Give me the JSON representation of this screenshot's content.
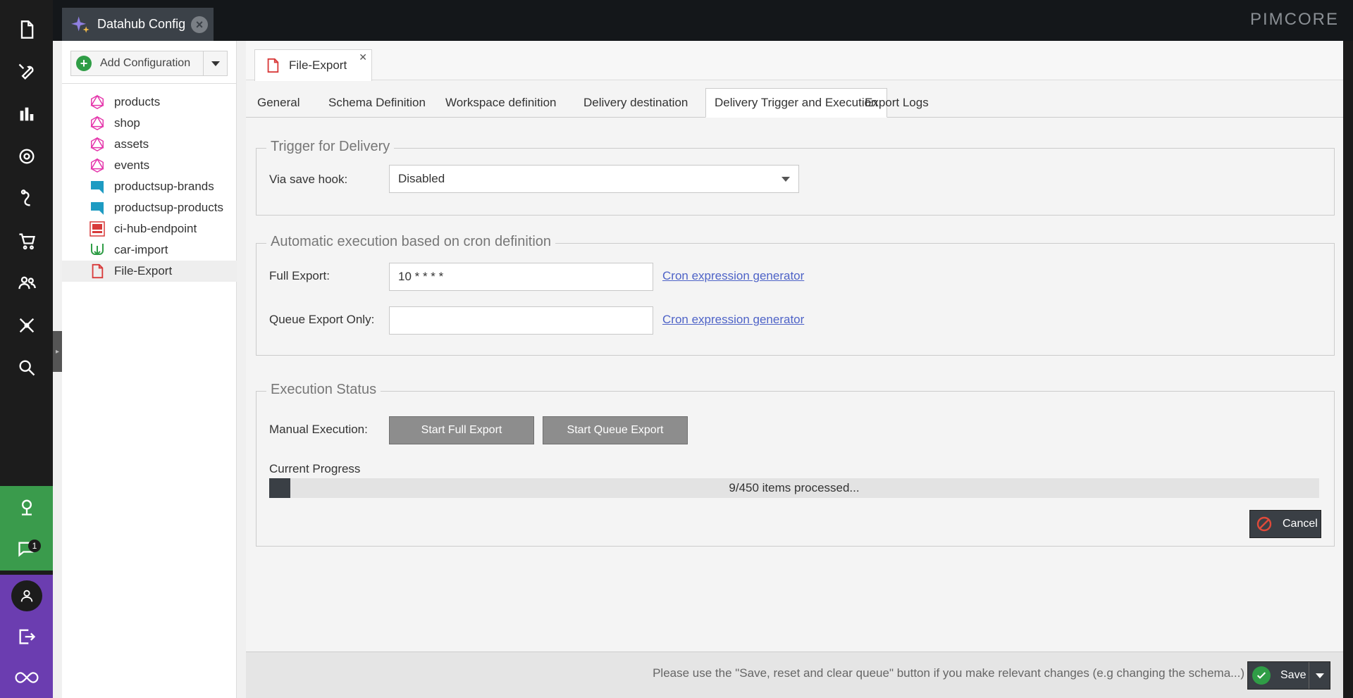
{
  "rail": {
    "icons": [
      "document-icon",
      "wrench-icon",
      "bar-chart-icon",
      "gear-icon",
      "marketing-icon",
      "cart-icon",
      "users-icon",
      "network-icon",
      "search-icon"
    ],
    "notifications_badge": "1"
  },
  "topbar": {
    "tab_label": "Datahub Config",
    "brand": "PIMCORE"
  },
  "tree": {
    "add_button_label": "Add Configuration",
    "items": [
      {
        "label": "products",
        "icon": "graphql-icon"
      },
      {
        "label": "shop",
        "icon": "graphql-icon"
      },
      {
        "label": "assets",
        "icon": "graphql-icon"
      },
      {
        "label": "events",
        "icon": "graphql-icon"
      },
      {
        "label": "productsup-brands",
        "icon": "productsup-icon"
      },
      {
        "label": "productsup-products",
        "icon": "productsup-icon"
      },
      {
        "label": "ci-hub-endpoint",
        "icon": "cihub-icon"
      },
      {
        "label": "car-import",
        "icon": "import-icon"
      },
      {
        "label": "File-Export",
        "icon": "file-icon"
      }
    ]
  },
  "doc": {
    "tab_label": "File-Export",
    "sub_tabs": [
      "General",
      "Schema Definition",
      "Workspace definition",
      "Delivery destination",
      "Delivery Trigger and Execution",
      "Export Logs"
    ]
  },
  "trigger": {
    "legend": "Trigger for Delivery",
    "save_hook_label": "Via save hook:",
    "save_hook_value": "Disabled"
  },
  "cron": {
    "legend": "Automatic execution based on cron definition",
    "full_label": "Full Export:",
    "full_value": "10 * * * *",
    "queue_label": "Queue Export Only:",
    "queue_value": "",
    "generator_link": "Cron expression generator"
  },
  "execution": {
    "legend": "Execution Status",
    "manual_label": "Manual Execution:",
    "start_full": "Start Full Export",
    "start_queue": "Start Queue Export",
    "progress_label": "Current Progress",
    "progress_text": "9/450 items processed...",
    "progress_fraction": 0.02,
    "cancel": "Cancel"
  },
  "footer": {
    "message": "Please use the \"Save, reset and clear queue\" button if you make relevant changes (e.g changing the schema...)",
    "save": "Save"
  },
  "colors": {
    "accent_green": "#3a9b4c",
    "accent_purple": "#6b3db0",
    "graphql_pink": "#e535ab",
    "link_blue": "#4e63c7"
  }
}
